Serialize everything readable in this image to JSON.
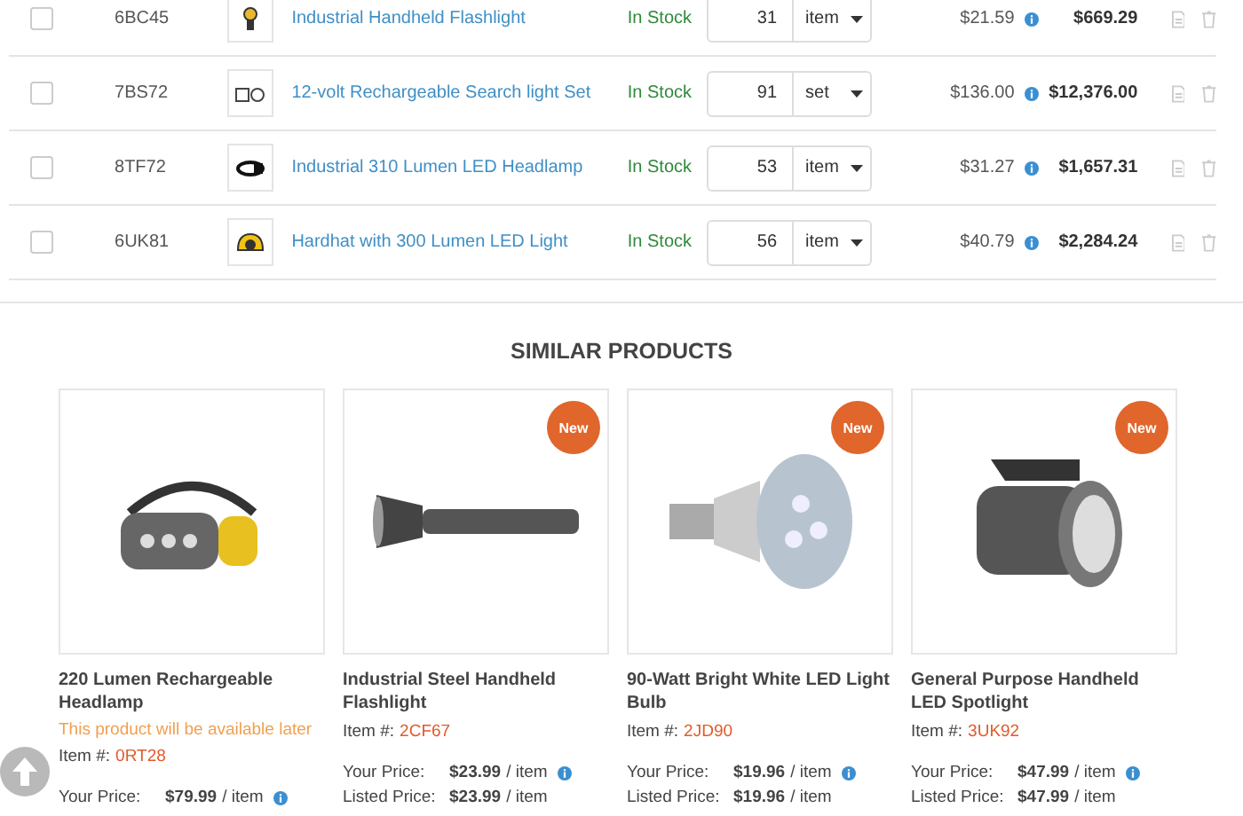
{
  "cart_rows": [
    {
      "checked": false,
      "code": "6BC45",
      "kind": "flashlight",
      "name": "Industrial Handheld Flashlight",
      "stock": "In Stock",
      "quantity": "31",
      "unit": "item",
      "price": "$21.59",
      "total": "$669.29"
    },
    {
      "checked": false,
      "code": "7BS72",
      "kind": "lamps",
      "name": "12-volt Rechargeable Search light Set",
      "stock": "In Stock",
      "quantity": "91",
      "unit": "set",
      "price": "$136.00",
      "total": "$12,376.00"
    },
    {
      "checked": false,
      "code": "8TF72",
      "kind": "headlamp",
      "name": "Industrial 310 Lumen LED Headlamp",
      "stock": "In Stock",
      "quantity": "53",
      "unit": "item",
      "price": "$31.27",
      "total": "$1,657.31"
    },
    {
      "checked": false,
      "code": "6UK81",
      "kind": "hardhat",
      "name": "Hardhat with 300 Lumen LED Light",
      "stock": "In Stock",
      "quantity": "56",
      "unit": "item",
      "price": "$40.79",
      "total": "$2,284.24"
    }
  ],
  "similar_products": {
    "title": "SIMILAR PRODUCTS",
    "items": [
      {
        "kind": "headlamp",
        "new": false,
        "name": "220 Lumen Rechargeable Headlamp",
        "note": "This product will be available later",
        "item_label": "Item #:",
        "item_number": "0RT28",
        "your_price_label": "Your Price:",
        "your_price": "$79.99",
        "your_price_unit": "/ item"
      },
      {
        "kind": "flashlight",
        "new": true,
        "badge": "New",
        "name": "Industrial Steel Handheld Flashlight",
        "item_label": "Item #:",
        "item_number": "2CF67",
        "your_price_label": "Your Price:",
        "your_price": "$23.99",
        "your_price_unit": "/ item",
        "listed_price_label": "Listed Price:",
        "listed_price": "$23.99",
        "listed_price_unit": "/ item"
      },
      {
        "kind": "bulb",
        "new": true,
        "badge": "New",
        "name": "90-Watt Bright White LED Light Bulb",
        "item_label": "Item #:",
        "item_number": "2JD90",
        "your_price_label": "Your Price:",
        "your_price": "$19.96",
        "your_price_unit": "/ item",
        "listed_price_label": "Listed Price:",
        "listed_price": "$19.96",
        "listed_price_unit": "/ item"
      },
      {
        "kind": "spotlight",
        "new": true,
        "badge": "New",
        "name": "General Purpose Handheld LED Spotlight",
        "item_label": "Item #:",
        "item_number": "3UK92",
        "your_price_label": "Your Price:",
        "your_price": "$47.99",
        "your_price_unit": "/ item",
        "listed_price_label": "Listed Price:",
        "listed_price": "$47.99",
        "listed_price_unit": "/ item"
      }
    ]
  }
}
